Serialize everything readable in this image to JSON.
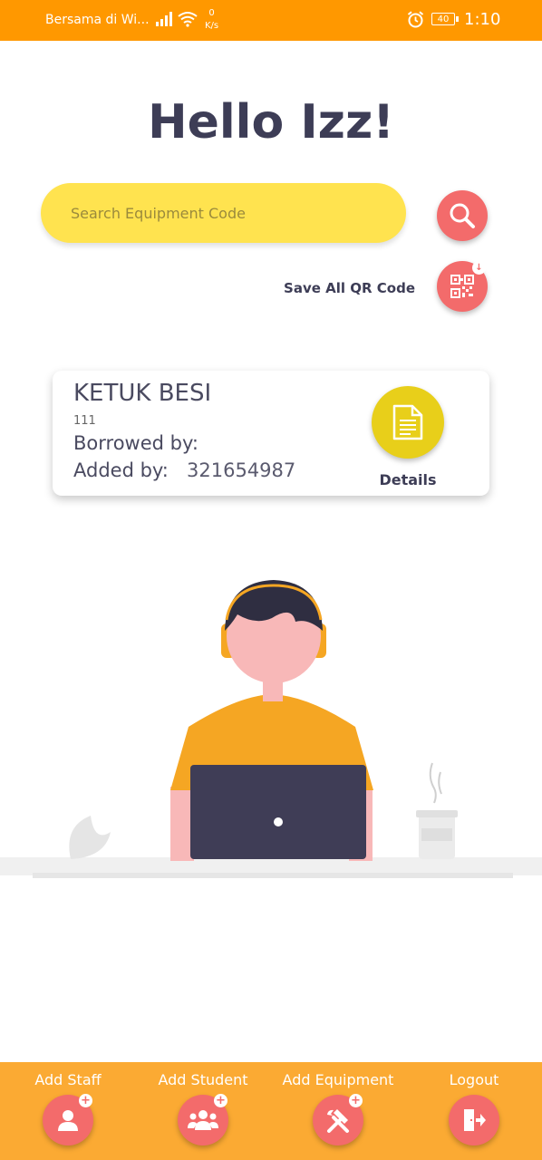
{
  "status_bar": {
    "carrier": "Bersama di Wi...",
    "speed_value": "0",
    "speed_unit": "K/s",
    "battery": "40",
    "time": "1:10"
  },
  "greeting": "Hello Izz!",
  "search": {
    "placeholder": "Search Equipment Code",
    "value": ""
  },
  "save_qr": {
    "label": "Save All QR Code"
  },
  "equipment_card": {
    "name": "KETUK BESI",
    "code": "111",
    "borrowed_label": "Borrowed by:",
    "borrowed_value": "",
    "added_label": "Added by:",
    "added_value": "321654987",
    "details_label": "Details"
  },
  "bottom_nav": {
    "items": [
      {
        "label": "Add Staff",
        "icon": "add-person-icon"
      },
      {
        "label": "Add Student",
        "icon": "add-group-icon"
      },
      {
        "label": "Add Equipment",
        "icon": "tools-icon"
      },
      {
        "label": "Logout",
        "icon": "logout-icon"
      }
    ]
  },
  "colors": {
    "status_bar": "#FF9800",
    "accent_red": "#F36B6B",
    "search_yellow": "#FFE34F",
    "details_yellow": "#E8CF1A",
    "bottom_bar": "#FBAA33",
    "text_dark": "#3d3d56"
  }
}
